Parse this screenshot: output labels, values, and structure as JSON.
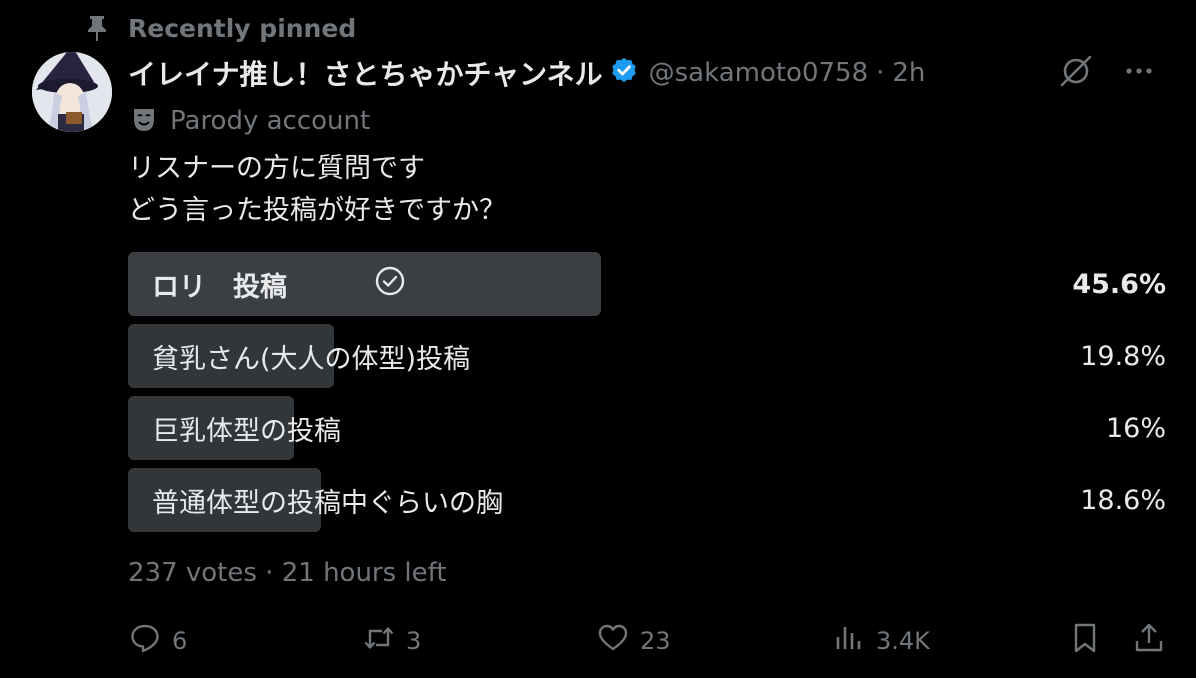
{
  "pinned": {
    "label": "Recently pinned",
    "icon": "pin-icon"
  },
  "author": {
    "display_name": "イレイナ推し！さとちゃかチャンネル",
    "handle": "@sakamoto0758",
    "separator": "·",
    "time": "2h",
    "verified_color": "#1d9bf0",
    "badge_icon": "theater-mask-icon",
    "badge_label": "Parody account"
  },
  "post": {
    "lines": [
      "リスナーの方に質問です",
      "どう言った投稿が好きですか？"
    ]
  },
  "poll": {
    "options": [
      {
        "label": "ロリ　投稿",
        "percent": "45.6%",
        "fraction": 0.456,
        "winner": true
      },
      {
        "label": "貧乳さん(大人の体型)投稿",
        "percent": "19.8%",
        "fraction": 0.198,
        "winner": false
      },
      {
        "label": "巨乳体型の投稿",
        "percent": "16%",
        "fraction": 0.16,
        "winner": false
      },
      {
        "label": "普通体型の投稿中ぐらいの胸",
        "percent": "18.6%",
        "fraction": 0.186,
        "winner": false
      }
    ],
    "meta": "237 votes · 21 hours left"
  },
  "actions": {
    "replies": "6",
    "reposts": "3",
    "likes": "23",
    "views": "3.4K"
  },
  "colors": {
    "background": "#000000",
    "text": "#e7e9ea",
    "muted": "#71767b",
    "bar": "#333639",
    "accent": "#1d9bf0"
  }
}
